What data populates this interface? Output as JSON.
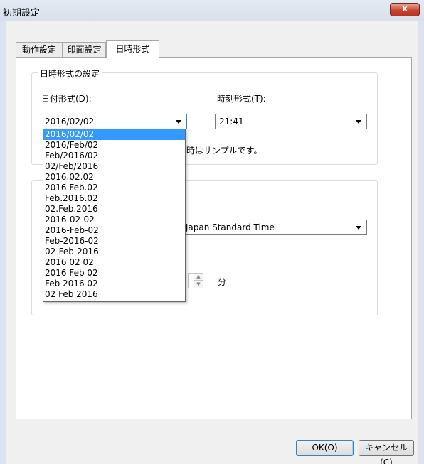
{
  "window": {
    "title": "初期設定",
    "close_label": "x"
  },
  "tabs": [
    {
      "label": "動作設定",
      "active": false
    },
    {
      "label": "印面設定",
      "active": false
    },
    {
      "label": "日時形式",
      "active": true
    }
  ],
  "datetime_group": {
    "title": "日時形式の設定",
    "date_label": "日付形式(D):",
    "date_value": "2016/02/02",
    "time_label": "時刻形式(T):",
    "time_value": "21:41",
    "sample_note": "時はサンプルです。"
  },
  "date_options": [
    "2016/02/02",
    "2016/Feb/02",
    "Feb/2016/02",
    "02/Feb/2016",
    "2016.02.02",
    "2016.Feb.02",
    "Feb.2016.02",
    "02.Feb.2016",
    "2016-02-02",
    "2016-Feb-02",
    "Feb-2016-02",
    "02-Feb-2016",
    "2016 02 02",
    "2016 Feb 02",
    "Feb 2016 02",
    "02 Feb 2016"
  ],
  "timezone_group": {
    "timezone_value": "T) Japan Standard Time",
    "minutes_unit": "分"
  },
  "buttons": {
    "ok": "OK(O)",
    "cancel": "キャンセル(C)"
  },
  "colors": {
    "selection": "#3399ff",
    "close_button": "#c7472f"
  }
}
